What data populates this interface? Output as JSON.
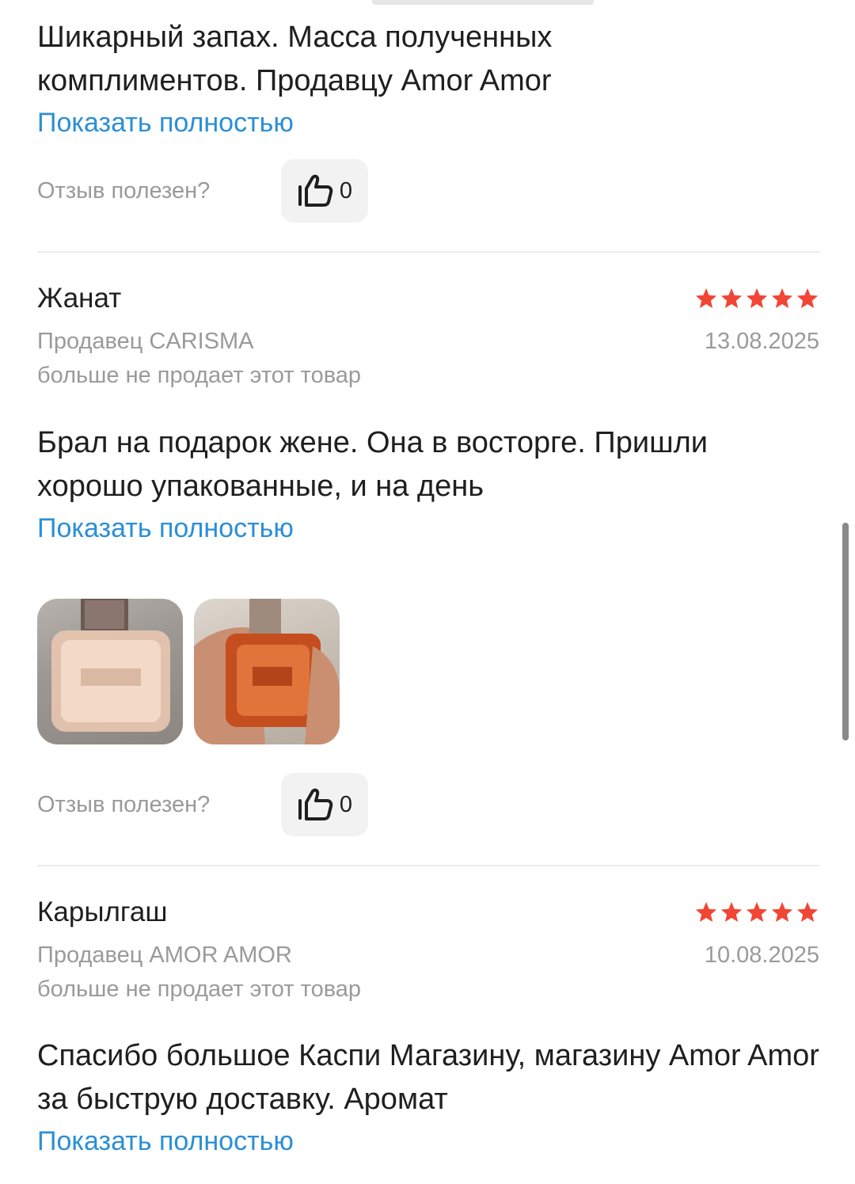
{
  "reviews": [
    {
      "text": "Шикарный запах. Масса полученных комплиментов. Продавцу Amor Amor",
      "show_more": "Показать полностью",
      "helpful_label": "Отзыв полезен?",
      "likes": "0"
    },
    {
      "author": "Жанат",
      "rating": 5,
      "seller": "Продавец CARISMA",
      "seller_status": "больше не продает этот товар",
      "date": "13.08.2025",
      "text": "Брал на подарок жене. Она в восторге. Пришли хорошо упакованные, и на день",
      "show_more": "Показать полностью",
      "helpful_label": "Отзыв полезен?",
      "likes": "0"
    },
    {
      "author": "Карылгаш",
      "rating": 5,
      "seller": "Продавец AMOR AMOR",
      "seller_status": "больше не продает этот товар",
      "date": "10.08.2025",
      "text": "Спасибо большое Каспи Магазину, магазину Amor Amor за быструю доставку. Аромат",
      "show_more": "Показать полностью"
    }
  ],
  "icons": {
    "like": "thumbs-up-icon",
    "star": "star-icon"
  },
  "colors": {
    "link": "#2b8fd6",
    "star": "#f14635",
    "muted_text": "#9a9a9a",
    "button_bg": "#f2f2f2"
  }
}
